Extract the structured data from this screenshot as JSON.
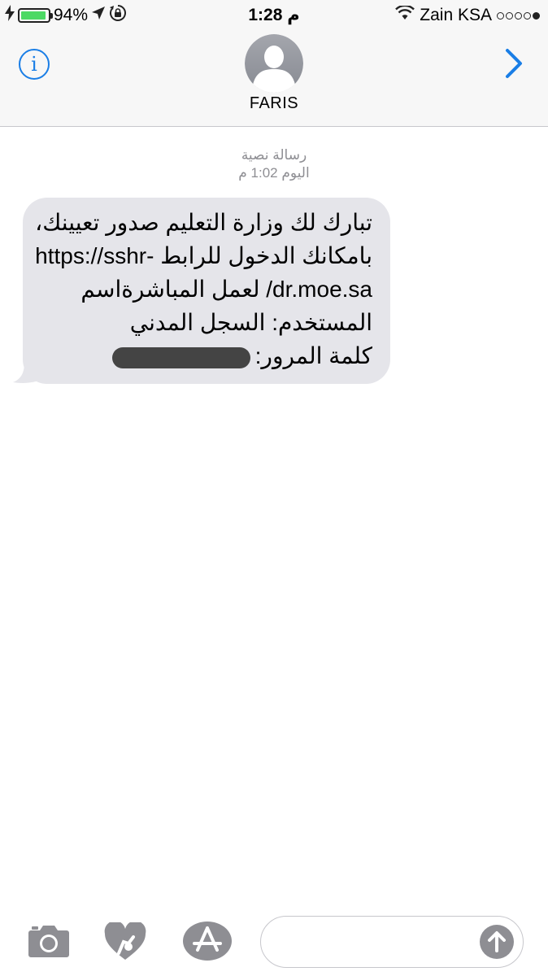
{
  "status_bar": {
    "battery_percent": "94%",
    "battery_level": 0.94,
    "time": "1:28 م",
    "carrier": "Zain KSA",
    "signal_bars": 1,
    "signal_total": 5
  },
  "header": {
    "contact_name": "FARIS",
    "info_icon": "info-icon",
    "forward_icon": "chevron-right-icon",
    "accent_color": "#1a7ee6"
  },
  "conversation": {
    "type_label": "رسالة نصية",
    "timestamp": "اليوم 1:02 م",
    "message": {
      "lines": [
        "تبارك لك وزارة التعليم صدور تعيينك،",
        "بامكانك الدخول للرابط -https://sshr",
        "dr.moe.sa/ لعمل المباشرةاسم",
        "المستخدم: السجل المدني",
        "كلمة المرور:"
      ],
      "bubble_color": "#e5e5ea"
    }
  },
  "bottom_bar": {
    "camera_icon": "camera-icon",
    "digital_touch_icon": "heart-touch-icon",
    "app_store_icon": "app-store-icon",
    "message_input_value": "",
    "send_icon": "send-arrow-icon"
  }
}
